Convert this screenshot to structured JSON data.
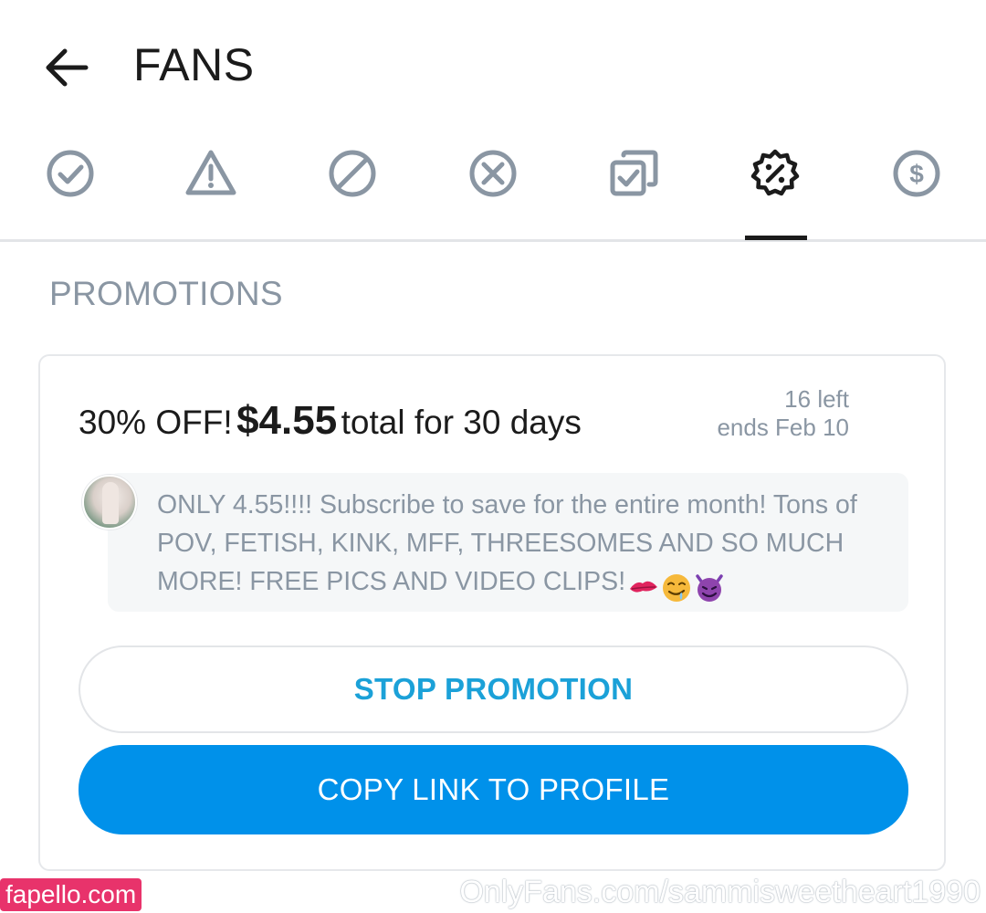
{
  "header": {
    "title": "FANS"
  },
  "tabs": [
    {
      "icon": "check-circle-icon"
    },
    {
      "icon": "warning-icon"
    },
    {
      "icon": "blocked-icon"
    },
    {
      "icon": "cancel-circle-icon"
    },
    {
      "icon": "copy-check-icon"
    },
    {
      "icon": "discount-badge-icon",
      "active": true
    },
    {
      "icon": "dollar-circle-icon"
    }
  ],
  "section": {
    "title": "PROMOTIONS"
  },
  "promotion": {
    "discount": "30% OFF!",
    "price": "$4.55",
    "duration": "total for 30 days",
    "remaining": "16 left",
    "ends": "ends Feb 10",
    "message": "ONLY 4.55!!!! Subscribe to save for the entire month! Tons of POV, FETISH, KINK, MFF, THREESOMES AND SO MUCH MORE! FREE PICS AND VIDEO CLIPS!",
    "emojis": [
      "kiss-mark-emoji",
      "drooling-face-emoji",
      "smiling-devil-emoji"
    ],
    "stop_label": "STOP PROMOTION",
    "copy_label": "COPY LINK TO PROFILE"
  },
  "watermarks": {
    "badge": "fapello.com",
    "url": "OnlyFans.com/sammisweetheart1990"
  },
  "colors": {
    "accent": "#0091ea",
    "secondary_text": "#8a96a3",
    "stop_text": "#1ba1d8",
    "active_tab": "#1b1b1b",
    "inactive_tab": "#8a96a3"
  }
}
